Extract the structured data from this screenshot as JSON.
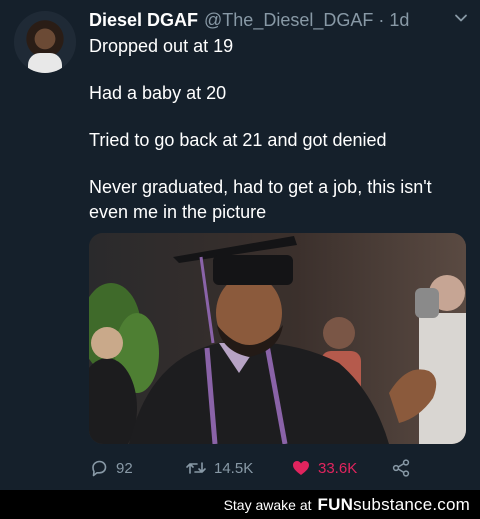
{
  "tweet": {
    "display_name": "Diesel DGAF",
    "handle": "@The_Diesel_DGAF",
    "separator": "·",
    "time": "1d",
    "lines": [
      "Dropped out at 19",
      "Had a baby at 20",
      "Tried to go back at 21 and got denied",
      "Never graduated, had to get a job, this isn't even me in the picture"
    ],
    "media_icon": "graduation-photo"
  },
  "actions": {
    "reply_count": "92",
    "retweet_count": "14.5K",
    "like_count": "33.6K",
    "liked": true,
    "icons": [
      "reply-icon",
      "retweet-icon",
      "heart-icon",
      "share-icon"
    ]
  },
  "footer": {
    "tagline": "Stay awake at",
    "logo_main": "FUN",
    "logo_sub": "substance",
    "logo_suffix": ".com"
  },
  "colors": {
    "background": "#15202b",
    "secondary_text": "#8899a6",
    "like": "#e0245e",
    "footer_bg": "#000000"
  }
}
